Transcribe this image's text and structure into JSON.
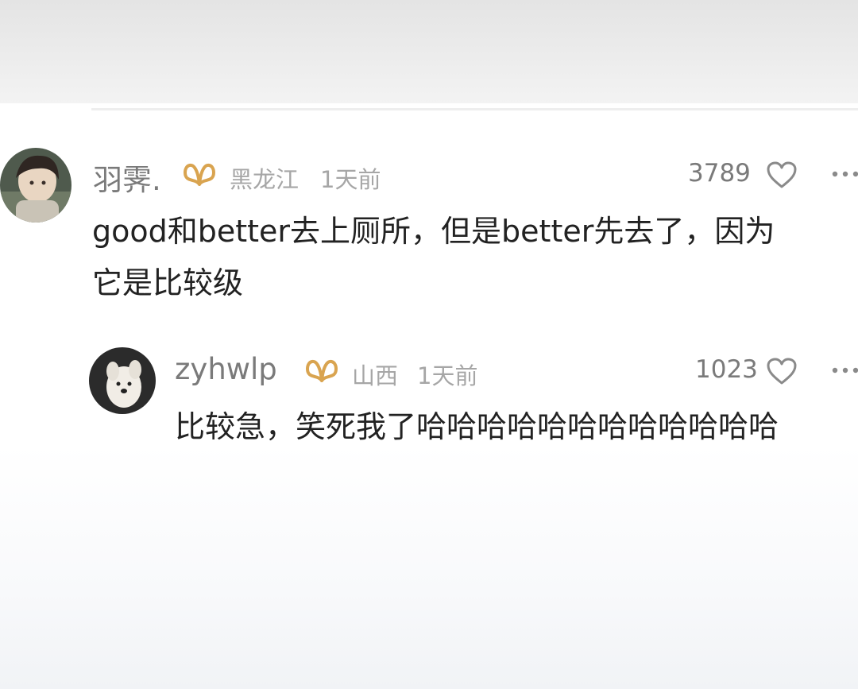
{
  "comment": {
    "username": "羽霁.",
    "badge_icon": "vip-badge-icon",
    "region": "黑龙江",
    "time": "1天前",
    "likes": "3789",
    "like_icon": "heart-icon",
    "more_icon": "more-icon",
    "text_line1": "good和better去上厕所，但是better先去了，因为",
    "text_line2": "它是比较级"
  },
  "reply": {
    "username": "zyhwlp",
    "badge_icon": "vip-badge-icon",
    "region": "山西",
    "time": "1天前",
    "likes": "1023",
    "like_icon": "heart-icon",
    "more_icon": "more-icon",
    "text": "比较急，笑死我了哈哈哈哈哈哈哈哈哈哈哈哈"
  },
  "colors": {
    "username": "#7a7a7a",
    "meta": "#a6a6a6",
    "text": "#222222",
    "badge": "#d9a450",
    "background": "#ffffff"
  }
}
